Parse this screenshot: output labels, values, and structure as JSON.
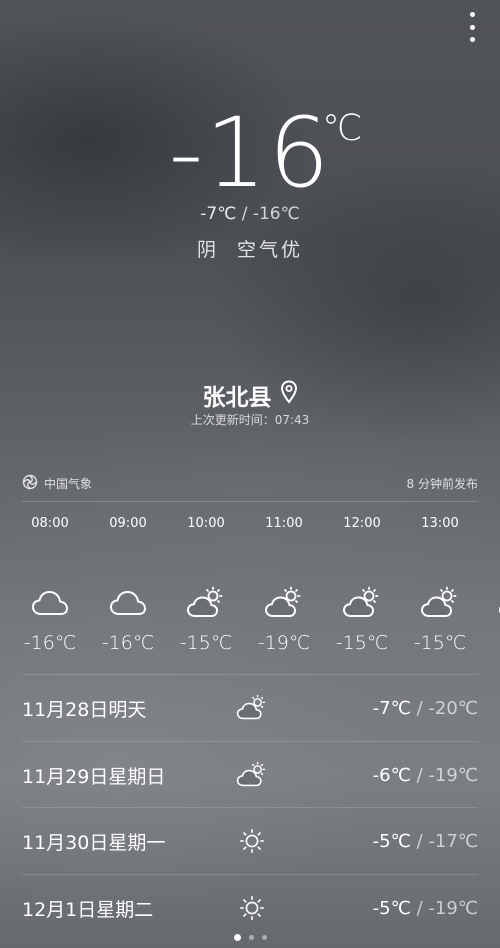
{
  "current": {
    "temp": "-16",
    "unit": "℃",
    "high": "-7℃",
    "sep": "/",
    "low": "-16℃",
    "condition": "阴  空气优"
  },
  "location": {
    "city": "张北县",
    "updated": "上次更新时间：07:43"
  },
  "source": {
    "name": "中国气象",
    "published": "8 分钟前发布"
  },
  "hourly": [
    {
      "time": "08:00",
      "icon": "cloud-icon",
      "temp": "-16℃"
    },
    {
      "time": "09:00",
      "icon": "cloud-icon",
      "temp": "-16℃"
    },
    {
      "time": "10:00",
      "icon": "partly-cloudy-icon",
      "temp": "-15℃"
    },
    {
      "time": "11:00",
      "icon": "partly-cloudy-icon",
      "temp": "-19℃"
    },
    {
      "time": "12:00",
      "icon": "partly-cloudy-icon",
      "temp": "-15℃"
    },
    {
      "time": "13:00",
      "icon": "partly-cloudy-icon",
      "temp": "-15℃"
    }
  ],
  "daily": [
    {
      "date": "11月28日明天",
      "icon": "partly-cloudy-icon",
      "high": "-7℃",
      "sep": "/",
      "low": "-20℃"
    },
    {
      "date": "11月29日星期日",
      "icon": "partly-cloudy-icon",
      "high": "-6℃",
      "sep": "/",
      "low": "-19℃"
    },
    {
      "date": "11月30日星期一",
      "icon": "sun-icon",
      "high": "-5℃",
      "sep": "/",
      "low": "-17℃"
    },
    {
      "date": "12月1日星期二",
      "icon": "sun-icon",
      "high": "-5℃",
      "sep": "/",
      "low": "-19℃"
    }
  ],
  "pager": {
    "count": 3,
    "active": 0
  }
}
